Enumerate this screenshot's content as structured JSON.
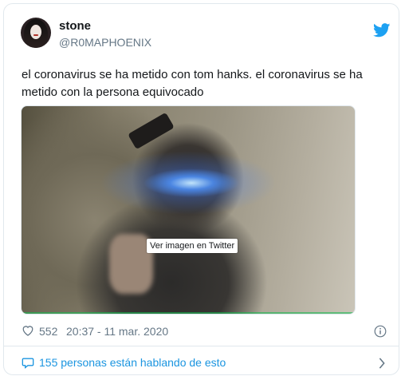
{
  "user": {
    "display_name": "stone",
    "handle": "@R0MAPHOENIX"
  },
  "tweet": {
    "text": "el coronavirus se ha metido con tom hanks. el coronavirus se ha metido con la persona equivocado"
  },
  "media": {
    "overlay_label": "Ver imagen en Twitter"
  },
  "meta": {
    "likes": "552",
    "timestamp": "20:37 - 11 mar. 2020"
  },
  "conversation": {
    "label": "155 personas están hablando de esto"
  },
  "colors": {
    "twitter_blue": "#1da1f2",
    "link_blue": "#1b95e0",
    "muted_text": "#657786",
    "border": "#e1e8ed"
  },
  "icons": {
    "brand": "twitter-bird-icon",
    "like": "heart-icon",
    "info": "info-icon",
    "reply": "speech-bubble-icon",
    "more": "chevron-right-icon"
  }
}
